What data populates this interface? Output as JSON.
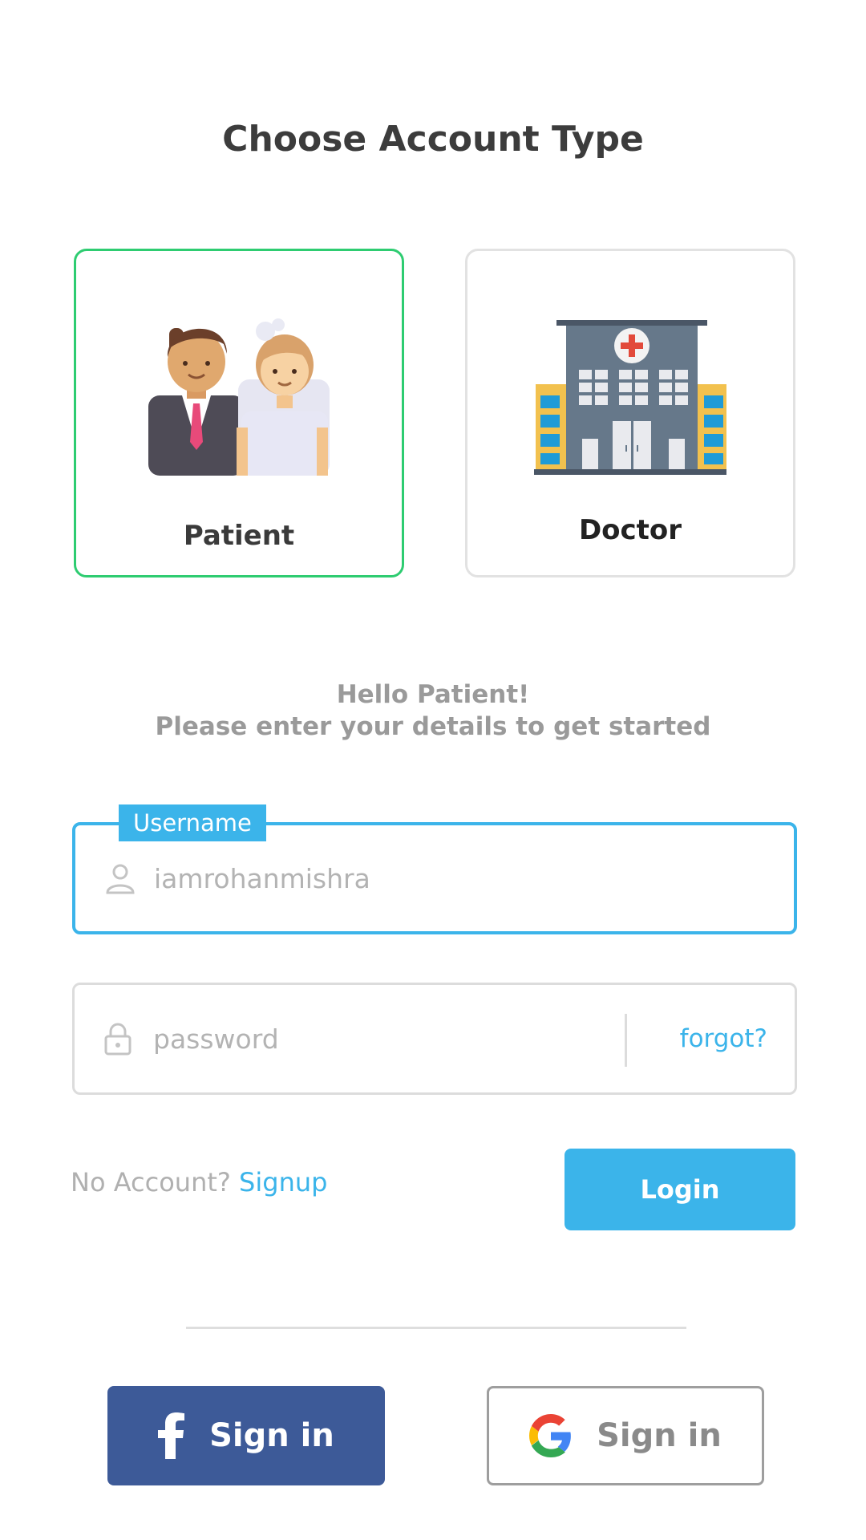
{
  "header": {
    "title": "Choose Account Type"
  },
  "account_types": [
    {
      "label": "Patient",
      "selected": true,
      "icon": "couple-icon"
    },
    {
      "label": "Doctor",
      "selected": false,
      "icon": "hospital-icon"
    }
  ],
  "greeting": {
    "line1": "Hello Patient!",
    "line2": "Please enter your details to get started"
  },
  "form": {
    "username": {
      "label": "Username",
      "placeholder": "iamrohanmishra",
      "icon": "user-icon"
    },
    "password": {
      "placeholder": "password",
      "icon": "lock-icon",
      "forgot_label": "forgot?"
    }
  },
  "footer": {
    "no_account": "No Account?",
    "signup_label": "Signup",
    "login_label": "Login"
  },
  "social": {
    "facebook_label": "Sign in",
    "google_label": "Sign in"
  },
  "colors": {
    "accent": "#3bb4ea",
    "selected_border": "#2ecc71",
    "facebook": "#3d5a98"
  }
}
